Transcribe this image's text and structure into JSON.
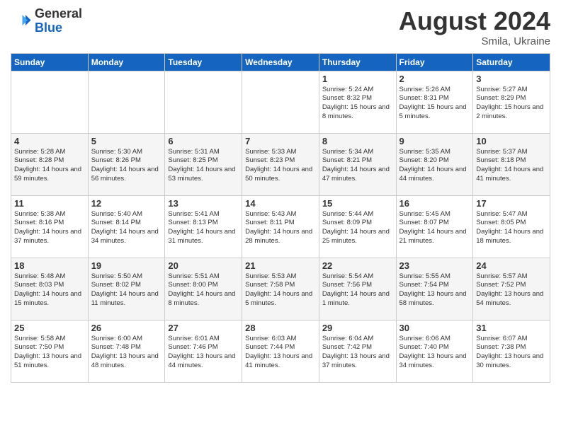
{
  "header": {
    "logo_general": "General",
    "logo_blue": "Blue",
    "month_year": "August 2024",
    "location": "Smila, Ukraine"
  },
  "days_of_week": [
    "Sunday",
    "Monday",
    "Tuesday",
    "Wednesday",
    "Thursday",
    "Friday",
    "Saturday"
  ],
  "weeks": [
    [
      {
        "day": "",
        "info": ""
      },
      {
        "day": "",
        "info": ""
      },
      {
        "day": "",
        "info": ""
      },
      {
        "day": "",
        "info": ""
      },
      {
        "day": "1",
        "info": "Sunrise: 5:24 AM\nSunset: 8:32 PM\nDaylight: 15 hours\nand 8 minutes."
      },
      {
        "day": "2",
        "info": "Sunrise: 5:26 AM\nSunset: 8:31 PM\nDaylight: 15 hours\nand 5 minutes."
      },
      {
        "day": "3",
        "info": "Sunrise: 5:27 AM\nSunset: 8:29 PM\nDaylight: 15 hours\nand 2 minutes."
      }
    ],
    [
      {
        "day": "4",
        "info": "Sunrise: 5:28 AM\nSunset: 8:28 PM\nDaylight: 14 hours\nand 59 minutes."
      },
      {
        "day": "5",
        "info": "Sunrise: 5:30 AM\nSunset: 8:26 PM\nDaylight: 14 hours\nand 56 minutes."
      },
      {
        "day": "6",
        "info": "Sunrise: 5:31 AM\nSunset: 8:25 PM\nDaylight: 14 hours\nand 53 minutes."
      },
      {
        "day": "7",
        "info": "Sunrise: 5:33 AM\nSunset: 8:23 PM\nDaylight: 14 hours\nand 50 minutes."
      },
      {
        "day": "8",
        "info": "Sunrise: 5:34 AM\nSunset: 8:21 PM\nDaylight: 14 hours\nand 47 minutes."
      },
      {
        "day": "9",
        "info": "Sunrise: 5:35 AM\nSunset: 8:20 PM\nDaylight: 14 hours\nand 44 minutes."
      },
      {
        "day": "10",
        "info": "Sunrise: 5:37 AM\nSunset: 8:18 PM\nDaylight: 14 hours\nand 41 minutes."
      }
    ],
    [
      {
        "day": "11",
        "info": "Sunrise: 5:38 AM\nSunset: 8:16 PM\nDaylight: 14 hours\nand 37 minutes."
      },
      {
        "day": "12",
        "info": "Sunrise: 5:40 AM\nSunset: 8:14 PM\nDaylight: 14 hours\nand 34 minutes."
      },
      {
        "day": "13",
        "info": "Sunrise: 5:41 AM\nSunset: 8:13 PM\nDaylight: 14 hours\nand 31 minutes."
      },
      {
        "day": "14",
        "info": "Sunrise: 5:43 AM\nSunset: 8:11 PM\nDaylight: 14 hours\nand 28 minutes."
      },
      {
        "day": "15",
        "info": "Sunrise: 5:44 AM\nSunset: 8:09 PM\nDaylight: 14 hours\nand 25 minutes."
      },
      {
        "day": "16",
        "info": "Sunrise: 5:45 AM\nSunset: 8:07 PM\nDaylight: 14 hours\nand 21 minutes."
      },
      {
        "day": "17",
        "info": "Sunrise: 5:47 AM\nSunset: 8:05 PM\nDaylight: 14 hours\nand 18 minutes."
      }
    ],
    [
      {
        "day": "18",
        "info": "Sunrise: 5:48 AM\nSunset: 8:03 PM\nDaylight: 14 hours\nand 15 minutes."
      },
      {
        "day": "19",
        "info": "Sunrise: 5:50 AM\nSunset: 8:02 PM\nDaylight: 14 hours\nand 11 minutes."
      },
      {
        "day": "20",
        "info": "Sunrise: 5:51 AM\nSunset: 8:00 PM\nDaylight: 14 hours\nand 8 minutes."
      },
      {
        "day": "21",
        "info": "Sunrise: 5:53 AM\nSunset: 7:58 PM\nDaylight: 14 hours\nand 5 minutes."
      },
      {
        "day": "22",
        "info": "Sunrise: 5:54 AM\nSunset: 7:56 PM\nDaylight: 14 hours\nand 1 minute."
      },
      {
        "day": "23",
        "info": "Sunrise: 5:55 AM\nSunset: 7:54 PM\nDaylight: 13 hours\nand 58 minutes."
      },
      {
        "day": "24",
        "info": "Sunrise: 5:57 AM\nSunset: 7:52 PM\nDaylight: 13 hours\nand 54 minutes."
      }
    ],
    [
      {
        "day": "25",
        "info": "Sunrise: 5:58 AM\nSunset: 7:50 PM\nDaylight: 13 hours\nand 51 minutes."
      },
      {
        "day": "26",
        "info": "Sunrise: 6:00 AM\nSunset: 7:48 PM\nDaylight: 13 hours\nand 48 minutes."
      },
      {
        "day": "27",
        "info": "Sunrise: 6:01 AM\nSunset: 7:46 PM\nDaylight: 13 hours\nand 44 minutes."
      },
      {
        "day": "28",
        "info": "Sunrise: 6:03 AM\nSunset: 7:44 PM\nDaylight: 13 hours\nand 41 minutes."
      },
      {
        "day": "29",
        "info": "Sunrise: 6:04 AM\nSunset: 7:42 PM\nDaylight: 13 hours\nand 37 minutes."
      },
      {
        "day": "30",
        "info": "Sunrise: 6:06 AM\nSunset: 7:40 PM\nDaylight: 13 hours\nand 34 minutes."
      },
      {
        "day": "31",
        "info": "Sunrise: 6:07 AM\nSunset: 7:38 PM\nDaylight: 13 hours\nand 30 minutes."
      }
    ]
  ]
}
